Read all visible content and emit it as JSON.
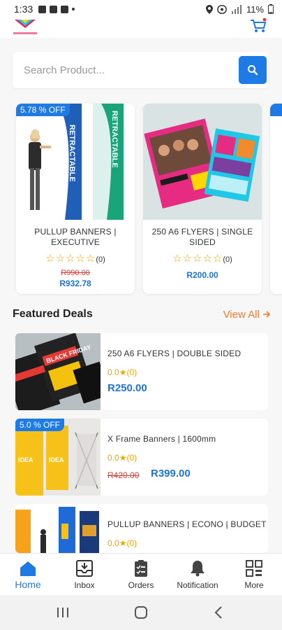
{
  "status_bar": {
    "time": "1:33",
    "battery": "11%"
  },
  "search": {
    "placeholder": "Search Product..."
  },
  "carousel": [
    {
      "badge": "5.78 % OFF",
      "title": "PULLUP BANNERS | EXECUTIVE",
      "stars": "☆☆☆☆☆",
      "count": "(0)",
      "old_price": "R990.00",
      "price": "R932.78",
      "banner_text": "RETRACTABLE"
    },
    {
      "badge": "",
      "title": "250 A6 FLYERS | SINGLE SIDED",
      "stars": "☆☆☆☆☆",
      "count": "(0)",
      "old_price": "",
      "price": "R200.00"
    }
  ],
  "featured": {
    "title": "Featured Deals",
    "view_all": "View All"
  },
  "deals": [
    {
      "badge": "",
      "title": "250 A6 FLYERS | DOUBLE SIDED",
      "rating": "0.0",
      "count": "(0)",
      "old_price": "",
      "price": "R250.00",
      "art_text": "BLACK FRIDAY"
    },
    {
      "badge": "5.0 % OFF",
      "title": "X Frame Banners | 1600mm",
      "rating": "0.0",
      "count": "(0)",
      "old_price": "R420.00",
      "price": "R399.00",
      "art_text": "IDEA"
    },
    {
      "badge": "",
      "title": "PULLUP BANNERS | ECONO | BUDGET",
      "rating": "0.0",
      "count": "(0)",
      "old_price": "",
      "price": "",
      "art_text": ""
    }
  ],
  "bottom_nav": [
    {
      "label": "Home",
      "icon": "home-icon",
      "active": true
    },
    {
      "label": "Inbox",
      "icon": "inbox-icon",
      "active": false
    },
    {
      "label": "Orders",
      "icon": "orders-icon",
      "active": false
    },
    {
      "label": "Notification",
      "icon": "bell-icon",
      "active": false
    },
    {
      "label": "More",
      "icon": "grid-icon",
      "active": false
    }
  ],
  "colors": {
    "accent": "#1e7be6",
    "price": "#1e73d8",
    "old_price": "#e53935",
    "view_all": "#f07b2b",
    "star": "#f0a500"
  }
}
